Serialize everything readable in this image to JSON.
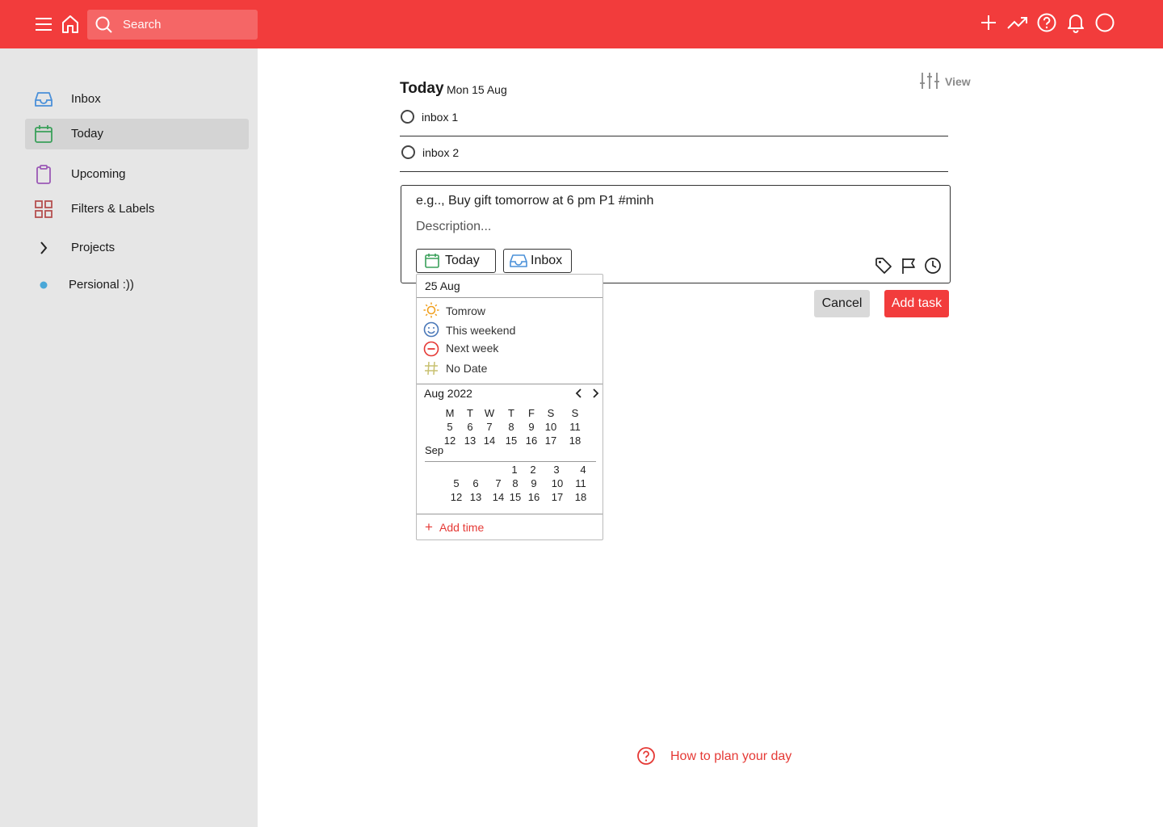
{
  "header": {
    "search_placeholder": "Search",
    "accent_color": "#f23c3c"
  },
  "sidebar": {
    "items": [
      {
        "label": "Inbox",
        "icon": "inbox-icon"
      },
      {
        "label": "Today",
        "icon": "calendar-icon",
        "active": true
      },
      {
        "label": "Upcoming",
        "icon": "clipboard-icon"
      },
      {
        "label": "Filters & Labels",
        "icon": "grid-icon"
      },
      {
        "label": "Projects",
        "icon": "chevron-right-icon"
      },
      {
        "label": "Persional :))",
        "icon": "dot-icon"
      }
    ]
  },
  "main": {
    "title": "Today",
    "date": "Mon 15 Aug",
    "view_label": "View",
    "tasks": [
      {
        "label": "inbox 1"
      },
      {
        "label": "inbox 2"
      }
    ]
  },
  "editor": {
    "name_placeholder": "e.g.., Buy gift tomorrow at 6 pm P1 #minh",
    "description_placeholder": "Description...",
    "date_chip": "Today",
    "project_chip": "Inbox",
    "cancel_label": "Cancel",
    "add_label": "Add task"
  },
  "date_picker": {
    "current": "25 Aug",
    "options": [
      {
        "label": "Tomrow",
        "icon": "sun-icon",
        "color": "#f0a020"
      },
      {
        "label": "This weekend",
        "icon": "smile-icon",
        "color": "#4a78b8"
      },
      {
        "label": "Next week",
        "icon": "minus-circle-icon",
        "color": "#e53935"
      },
      {
        "label": "No Date",
        "icon": "hash-icon",
        "color": "#c8c070"
      }
    ],
    "month_label": "Aug 2022",
    "weekdays": [
      "M",
      "T",
      "W",
      "T",
      "F",
      "S",
      "S"
    ],
    "aug_rows": [
      [
        "5",
        "6",
        "7",
        "8",
        "9",
        "10",
        "11"
      ],
      [
        "12",
        "13",
        "14",
        "15",
        "16",
        "17",
        "18"
      ]
    ],
    "next_month_label": "Sep",
    "sep_rows": [
      [
        "",
        "",
        "",
        "1",
        "2",
        "3",
        "4"
      ],
      [
        "5",
        "6",
        "7",
        "8",
        "9",
        "10",
        "11"
      ],
      [
        "12",
        "13",
        "14",
        "15",
        "16",
        "17",
        "18"
      ]
    ],
    "add_time_plus": "+",
    "add_time_label": "Add  time"
  },
  "help": {
    "label": "How to plan your day"
  }
}
